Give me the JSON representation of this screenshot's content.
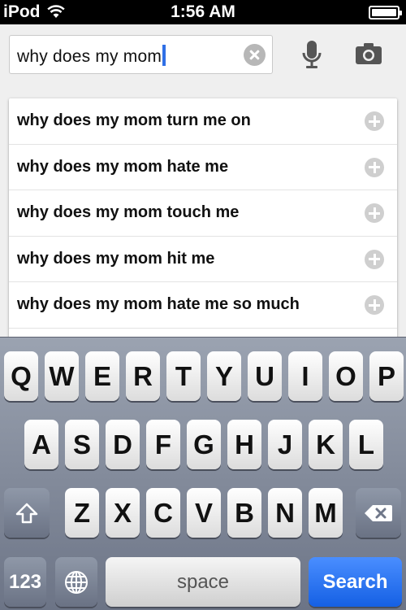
{
  "status_bar": {
    "carrier": "iPod",
    "time": "1:56 AM",
    "wifi_icon": "wifi-icon",
    "battery_icon": "battery-icon"
  },
  "search": {
    "query": "why does my mom",
    "clear_icon": "clear-icon",
    "mic_icon": "microphone-icon",
    "camera_icon": "camera-icon"
  },
  "suggestions": [
    {
      "text": "why does my mom turn me on"
    },
    {
      "text": "why does my mom hate me"
    },
    {
      "text": "why does my mom touch me"
    },
    {
      "text": "why does my mom hit me"
    },
    {
      "text": "why does my mom hate me so much"
    }
  ],
  "keyboard": {
    "row1": [
      "Q",
      "W",
      "E",
      "R",
      "T",
      "Y",
      "U",
      "I",
      "O",
      "P"
    ],
    "row2": [
      "A",
      "S",
      "D",
      "F",
      "G",
      "H",
      "J",
      "K",
      "L"
    ],
    "row3": [
      "Z",
      "X",
      "C",
      "V",
      "B",
      "N",
      "M"
    ],
    "numbers_label": "123",
    "space_label": "space",
    "search_label": "Search",
    "shift_icon": "shift-icon",
    "delete_icon": "delete-icon",
    "globe_icon": "globe-icon"
  },
  "colors": {
    "search_key": "#1f6cf0",
    "caret": "#2f6fe6"
  }
}
